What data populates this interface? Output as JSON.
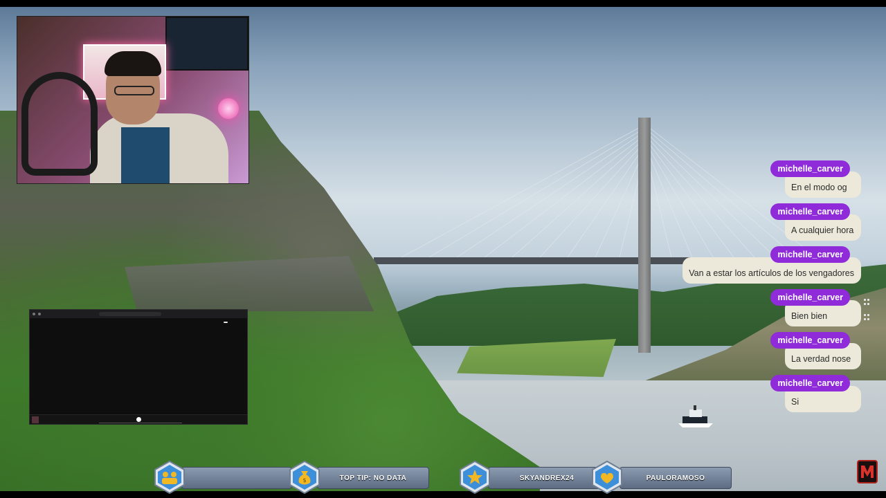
{
  "chat": {
    "messages": [
      {
        "user": "michelle_carver",
        "text": "En el modo og"
      },
      {
        "user": "michelle_carver",
        "text": "A cualquier hora"
      },
      {
        "user": "michelle_carver",
        "text": "Van a estar los artículos de los vengadores"
      },
      {
        "user": "michelle_carver",
        "text": "Bien bien"
      },
      {
        "user": "michelle_carver",
        "text": "La verdad nose"
      },
      {
        "user": "michelle_carver",
        "text": "Si"
      }
    ]
  },
  "ticker": {
    "plate1": "",
    "plate2": "TOP TIP: NO DATA",
    "plate3": "SKYANDREX24",
    "plate4": "PAULORAMOSO"
  },
  "browser": {
    "url": "",
    "page_title": "",
    "subscribe_label": "",
    "track": ""
  },
  "colors": {
    "chat_username_bg": "#8f2bd9",
    "chat_bubble_bg": "#ece9da",
    "plate_top": "#8b9bb0",
    "plate_bottom": "#5d6c82",
    "badge_blue": "#3e8fd9",
    "badge_gold": "#f2b824"
  },
  "icons": [
    "webcam-overlay",
    "browser-window",
    "play-icon",
    "money-bag-icon",
    "star-icon",
    "heart-hand-icon",
    "crowd-icon",
    "channel-logo-icon"
  ]
}
